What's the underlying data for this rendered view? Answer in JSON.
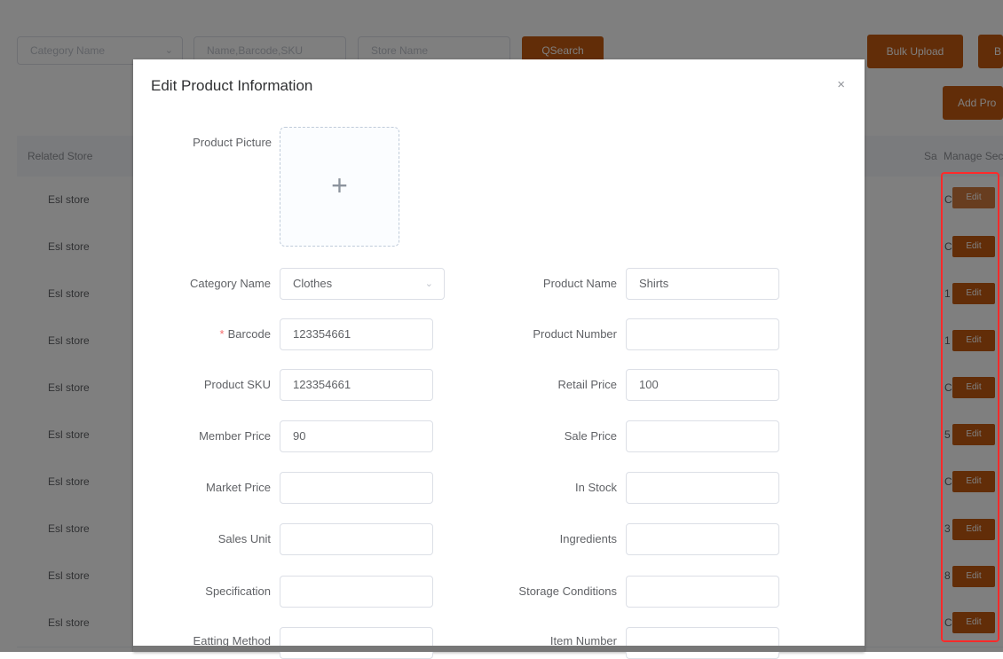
{
  "filters": {
    "category_placeholder": "Category Name",
    "search_placeholder": "Name,Barcode,SKU",
    "store_placeholder": "Store Name",
    "search_button": "QSearch"
  },
  "toolbar": {
    "bulk_upload": "Bulk Upload",
    "extra_button": "B",
    "add_product": "Add Pro"
  },
  "table": {
    "headers": {
      "related_store": "Related Store",
      "sa": "Sa",
      "manage": "Manage Sec"
    },
    "rows": [
      {
        "store": "Esl store",
        "sa": "C",
        "action": "Edit"
      },
      {
        "store": "Esl store",
        "sa": "C",
        "action": "Edit"
      },
      {
        "store": "Esl store",
        "sa": "1",
        "action": "Edit"
      },
      {
        "store": "Esl store",
        "sa": "1",
        "action": "Edit"
      },
      {
        "store": "Esl store",
        "sa": "C",
        "action": "Edit"
      },
      {
        "store": "Esl store",
        "sa": "5",
        "action": "Edit"
      },
      {
        "store": "Esl store",
        "sa": "C",
        "action": "Edit"
      },
      {
        "store": "Esl store",
        "sa": "3",
        "action": "Edit"
      },
      {
        "store": "Esl store",
        "sa": "8",
        "action": "Edit"
      },
      {
        "store": "Esl store",
        "sa": "C",
        "action": "Edit"
      }
    ]
  },
  "modal": {
    "title": "Edit Product Information",
    "close_icon": "×",
    "picture_label": "Product Picture",
    "upload_icon": "+",
    "fields": {
      "category_name": {
        "label": "Category Name",
        "value": "Clothes"
      },
      "product_name": {
        "label": "Product Name",
        "value": "Shirts"
      },
      "barcode": {
        "label": "Barcode",
        "required_mark": "*",
        "value": "123354661"
      },
      "product_number": {
        "label": "Product Number",
        "value": ""
      },
      "product_sku": {
        "label": "Product SKU",
        "value": "123354661"
      },
      "retail_price": {
        "label": "Retail Price",
        "value": "100"
      },
      "member_price": {
        "label": "Member Price",
        "value": "90"
      },
      "sale_price": {
        "label": "Sale Price",
        "value": ""
      },
      "market_price": {
        "label": "Market Price",
        "value": ""
      },
      "in_stock": {
        "label": "In Stock",
        "value": ""
      },
      "sales_unit": {
        "label": "Sales Unit",
        "value": ""
      },
      "ingredients": {
        "label": "Ingredients",
        "value": ""
      },
      "specification": {
        "label": "Specification",
        "value": ""
      },
      "storage_conditions": {
        "label": "Storage Conditions",
        "value": ""
      },
      "eatting_method": {
        "label": "Eatting Method",
        "value": ""
      },
      "item_number": {
        "label": "Item Number",
        "value": ""
      }
    }
  },
  "colors": {
    "accent": "#c55a11",
    "highlight_border": "#ff2a2a"
  }
}
